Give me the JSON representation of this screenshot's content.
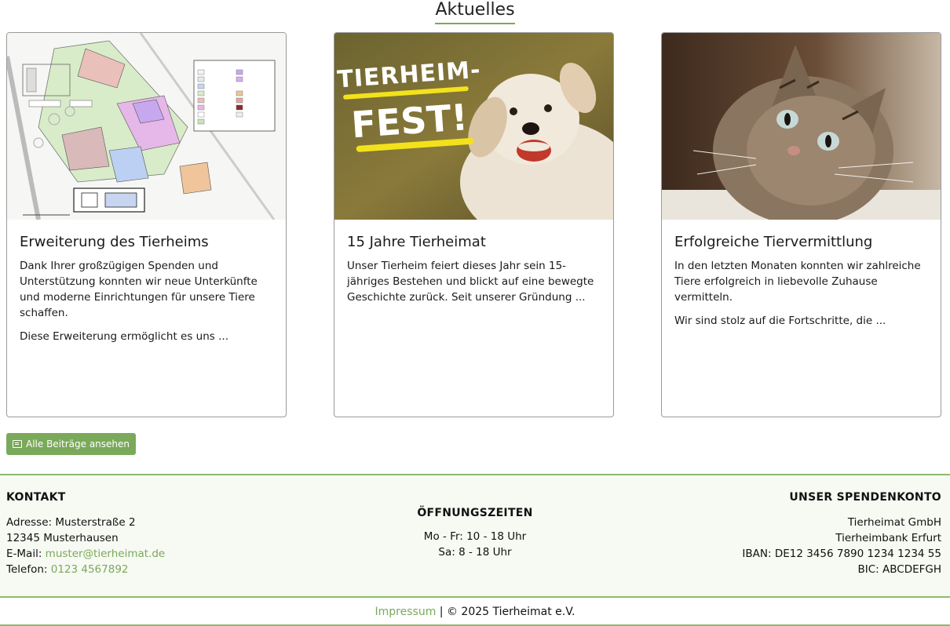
{
  "section": {
    "title": "Aktuelles"
  },
  "cards": [
    {
      "title": "Erweiterung des Tierheims",
      "paragraphs": [
        "Dank Ihrer großzügigen Spenden und Unterstützung konnten wir neue Unterkünfte und moderne Einrichtungen für unsere Tiere schaffen.",
        "Diese Erweiterung ermöglicht es uns ..."
      ],
      "image": "site-plan"
    },
    {
      "title": "15 Jahre Tierheimat",
      "paragraphs": [
        "Unser Tierheim feiert dieses Jahr sein 15-jähriges Bestehen und blickt auf eine bewegte Geschichte zurück. Seit unserer Gründung ..."
      ],
      "image": "puppy-fest",
      "image_text": {
        "line1": "TIERHEIM-",
        "line2": "FEST!"
      }
    },
    {
      "title": "Erfolgreiche Tiervermittlung",
      "paragraphs": [
        "In den letzten Monaten konnten wir zahlreiche Tiere erfolgreich in liebevolle Zuhause vermitteln.",
        "Wir sind stolz auf die Fortschritte, die ..."
      ],
      "image": "cat-photo"
    }
  ],
  "button": {
    "label": "Alle Beiträge ansehen",
    "icon": "newspaper-icon"
  },
  "footer": {
    "contact": {
      "heading": "KONTAKT",
      "address1": "Adresse: Musterstraße 2",
      "address2": "12345 Musterhausen",
      "email_label": "E-Mail: ",
      "email": "muster@tierheimat.de",
      "phone_label": "Telefon: ",
      "phone": "0123 4567892"
    },
    "hours": {
      "heading": "ÖFFNUNGSZEITEN",
      "weekday": "Mo - Fr: 10 - 18 Uhr",
      "saturday": "Sa: 8 - 18 Uhr"
    },
    "donation": {
      "heading": "UNSER SPENDENKONTO",
      "name": "Tierheimat GmbH",
      "bank": "Tierheimbank Erfurt",
      "iban": "IBAN: DE12 3456 7890 1234 1234 55",
      "bic": "BIC: ABCDEFGH"
    }
  },
  "bottom": {
    "impressum": "Impressum",
    "copyright": " | © 2025 Tierheimat e.V."
  },
  "colors": {
    "accent": "#7aa95a",
    "border": "#8cbb6b"
  }
}
